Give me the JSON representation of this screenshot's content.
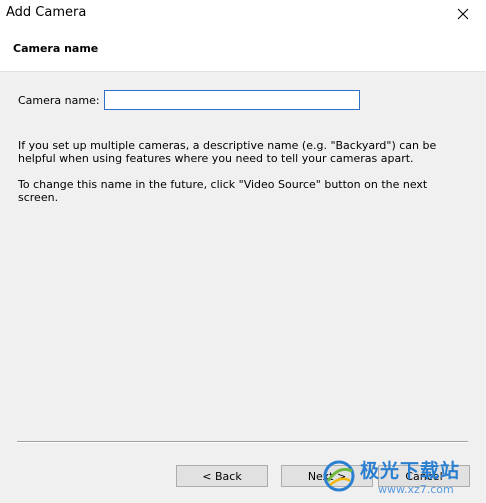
{
  "window": {
    "title": "Add Camera"
  },
  "header": {
    "title": "Camera name"
  },
  "form": {
    "name_label": "Camera name:",
    "name_value": "",
    "help_text_1": "If you set up multiple cameras, a descriptive name (e.g. \"Backyard\") can be helpful when using features where you need to tell your cameras apart.",
    "help_text_2": "To change this name in the future, click \"Video Source\" button on the next screen."
  },
  "buttons": {
    "back": "< Back",
    "next": "Next >",
    "cancel": "Cancel"
  },
  "watermark": {
    "text": "极光下载站",
    "url": "www.xz7.com"
  },
  "colors": {
    "input_border": "#2f6fc8",
    "watermark_blue": "#2b7fd1"
  }
}
